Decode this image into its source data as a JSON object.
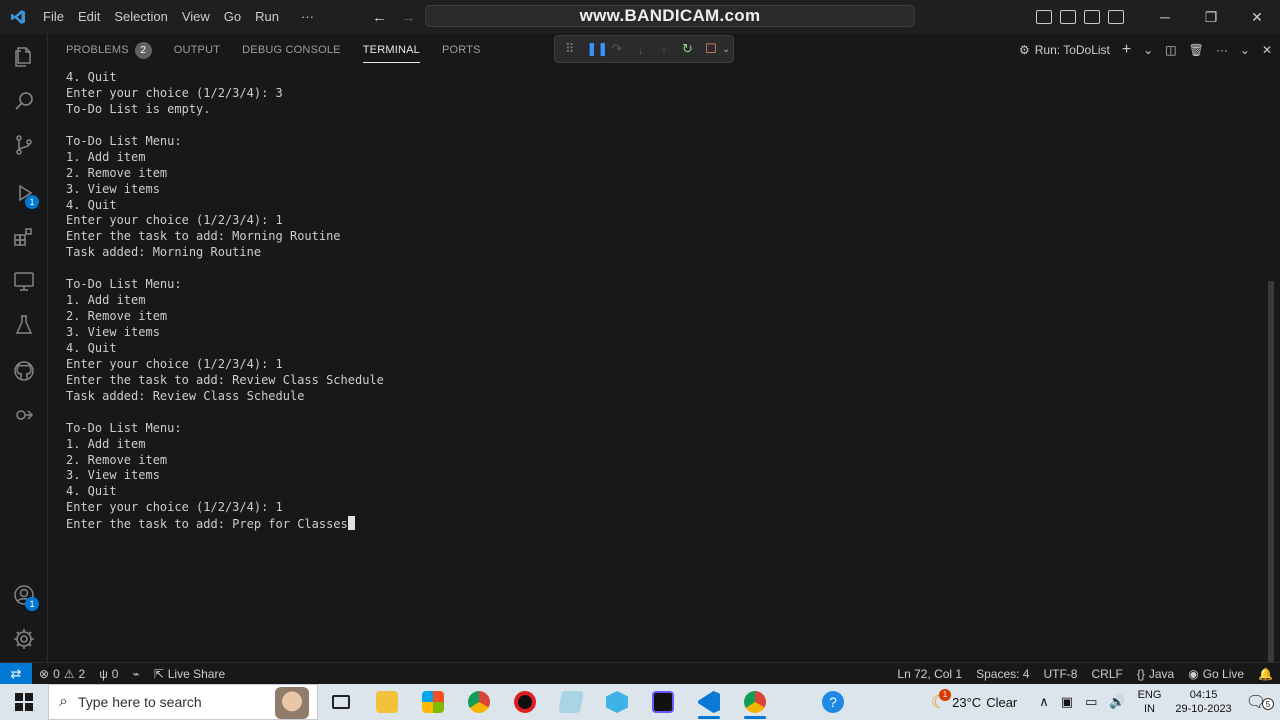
{
  "titlebar": {
    "menu": [
      "File",
      "Edit",
      "Selection",
      "View",
      "Go",
      "Run"
    ],
    "more": "···",
    "watermark": "www.BANDICAM.com"
  },
  "panel": {
    "tabs": [
      {
        "label": "PROBLEMS",
        "badge": "2"
      },
      {
        "label": "OUTPUT"
      },
      {
        "label": "DEBUG CONSOLE"
      },
      {
        "label": "TERMINAL"
      },
      {
        "label": "PORTS"
      }
    ],
    "active_tab": "TERMINAL",
    "run_label": "Run: ToDoList"
  },
  "activity_badges": {
    "run": "1",
    "account": "1"
  },
  "terminal": {
    "lines": [
      "4. Quit",
      "Enter your choice (1/2/3/4): 3",
      "To-Do List is empty.",
      "",
      "To-Do List Menu:",
      "1. Add item",
      "2. Remove item",
      "3. View items",
      "4. Quit",
      "Enter your choice (1/2/3/4): 1",
      "Enter the task to add: Morning Routine",
      "Task added: Morning Routine",
      "",
      "To-Do List Menu:",
      "1. Add item",
      "2. Remove item",
      "3. View items",
      "4. Quit",
      "Enter your choice (1/2/3/4): 1",
      "Enter the task to add: Review Class Schedule",
      "Task added: Review Class Schedule",
      "",
      "To-Do List Menu:",
      "1. Add item",
      "2. Remove item",
      "3. View items",
      "4. Quit",
      "Enter your choice (1/2/3/4): 1"
    ],
    "current_input": "Enter the task to add: Prep for Classes"
  },
  "statusbar": {
    "errors": "0",
    "warnings": "2",
    "ports": "0",
    "live_share": "Live Share",
    "position": "Ln 72, Col 1",
    "spaces": "Spaces: 4",
    "encoding": "UTF-8",
    "eol": "CRLF",
    "language": "Java",
    "go_live": "Go Live"
  },
  "taskbar": {
    "search_placeholder": "Type here to search",
    "weather_temp": "23°C",
    "weather_desc": "Clear",
    "weather_badge": "1",
    "lang_line1": "ENG",
    "lang_line2": "IN",
    "time": "04:15",
    "date": "29-10-2023",
    "notification_count": "5"
  },
  "colors": {
    "accent": "#0078d4",
    "background": "#181818",
    "terminal_text": "#cccccc"
  }
}
